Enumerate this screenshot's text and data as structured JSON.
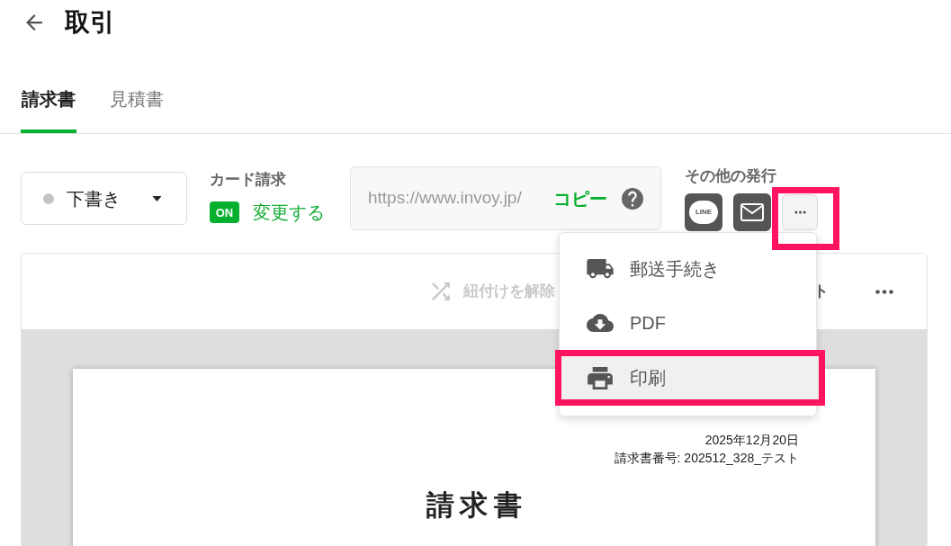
{
  "header": {
    "title": "取引"
  },
  "tabs": [
    {
      "label": "請求書",
      "selected": true
    },
    {
      "label": "見積書",
      "selected": false
    }
  ],
  "status_dropdown": {
    "value": "下書き"
  },
  "card_billing": {
    "label": "カード請求",
    "status": {
      "label": "ON",
      "on": true
    },
    "change_link": "変更する"
  },
  "share_url": {
    "value": "https://www.invoy.jp/",
    "copy_button": "コピー"
  },
  "other_issue": {
    "label": "その他の発行",
    "line_button": "LINE",
    "more_button": {
      "expanded": true,
      "highlighted": true
    }
  },
  "issue_menu": [
    {
      "kind": "post",
      "label": "郵送手続き",
      "selected": false,
      "highlighted": false
    },
    {
      "kind": "pdf",
      "label": "PDF",
      "selected": false,
      "highlighted": false
    },
    {
      "kind": "print",
      "label": "印刷",
      "selected": true,
      "highlighted": true
    }
  ],
  "toolbar": {
    "unlink_button": {
      "label": "紐付けを解除",
      "disabled": true
    },
    "partial_button": "ト"
  },
  "document": {
    "date": "2025年12月20日",
    "invoice_number": "請求書番号: 202512_328_テスト",
    "title": "請求書"
  }
}
